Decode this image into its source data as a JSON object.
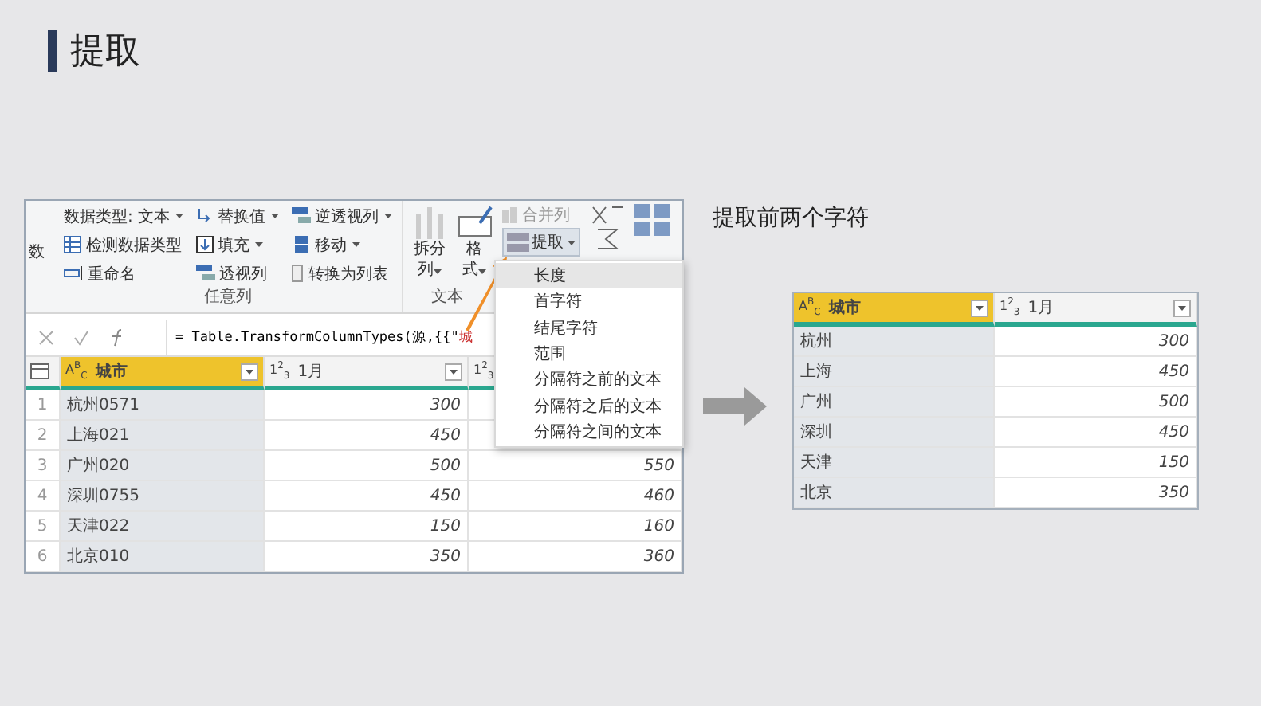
{
  "title": "提取",
  "ribbon": {
    "cut_label": "数",
    "columns": [
      [
        {
          "label": "数据类型: 文本",
          "dropdown": true
        },
        {
          "label": "检测数据类型",
          "dropdown": false
        },
        {
          "label": "重命名",
          "dropdown": false
        }
      ],
      [
        {
          "label": "替换值",
          "dropdown": true
        },
        {
          "label": "填充",
          "dropdown": true
        },
        {
          "label": "透视列",
          "dropdown": false
        }
      ],
      [
        {
          "label": "逆透视列",
          "dropdown": true
        },
        {
          "label": "移动",
          "dropdown": true
        },
        {
          "label": "转换为列表",
          "dropdown": false
        }
      ]
    ],
    "group_label": "任意列",
    "split": {
      "line1": "拆分",
      "line2": "列",
      "dropdown": true
    },
    "format": {
      "line1": "格",
      "line2": "式",
      "dropdown": true
    },
    "merge": "合并列",
    "extract": "提取",
    "text_group_label": "文本"
  },
  "formula": {
    "text": "= Table.TransformColumnTypes(源,{{\"",
    "highlight": "城"
  },
  "left_table": {
    "columns": [
      {
        "label": "城市",
        "type_label": "A$^{B}$$_{C}$",
        "selected": true
      },
      {
        "label": "1月",
        "type_label": "1$^{2}$$_{3}$",
        "selected": false
      },
      {
        "type_label": "1$^{2}$$_{3}$",
        "selected": false
      }
    ],
    "rows": [
      {
        "index": "1",
        "cells": [
          "杭州0571",
          "300"
        ]
      },
      {
        "index": "2",
        "cells": [
          "上海021",
          "450"
        ]
      },
      {
        "index": "3",
        "cells": [
          "广州020",
          "500",
          "550"
        ]
      },
      {
        "index": "4",
        "cells": [
          "深圳0755",
          "450",
          "460"
        ]
      },
      {
        "index": "5",
        "cells": [
          "天津022",
          "150",
          "160"
        ]
      },
      {
        "index": "6",
        "cells": [
          "北京010",
          "350",
          "360"
        ]
      }
    ]
  },
  "menu": {
    "items": [
      {
        "label": "长度",
        "selected": true
      },
      {
        "label": "首字符",
        "selected": false
      },
      {
        "label": "结尾字符",
        "selected": false
      },
      {
        "label": "范围",
        "selected": false
      },
      {
        "label": "分隔符之前的文本",
        "selected": false
      },
      {
        "label": "分隔符之后的文本",
        "selected": false
      },
      {
        "label": "分隔符之间的文本",
        "selected": false
      }
    ]
  },
  "result_caption": "提取前两个字符",
  "right_table": {
    "columns": [
      {
        "label": "城市",
        "type_label": "A$^{B}$$_{C}$",
        "selected": true
      },
      {
        "label": "1月",
        "type_label": "1$^{2}$$_{3}$",
        "selected": false
      }
    ],
    "rows": [
      {
        "cells": [
          "杭州",
          "300"
        ]
      },
      {
        "cells": [
          "上海",
          "450"
        ]
      },
      {
        "cells": [
          "广州",
          "500"
        ]
      },
      {
        "cells": [
          "深圳",
          "450"
        ]
      },
      {
        "cells": [
          "天津",
          "150"
        ]
      },
      {
        "cells": [
          "北京",
          "350"
        ]
      }
    ]
  }
}
